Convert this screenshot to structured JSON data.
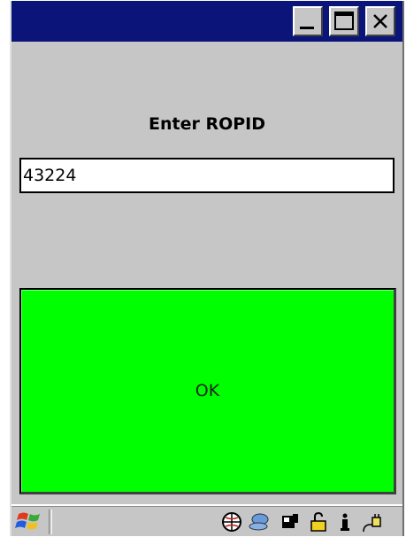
{
  "window": {
    "title": "",
    "controls": {
      "minimize": "minimize-icon",
      "maximize": "maximize-icon",
      "close": "close-icon"
    }
  },
  "main": {
    "prompt_label": "Enter ROPID",
    "ropid_value": "43224",
    "ok_label": "OK",
    "ok_color": "#00ff00"
  },
  "taskbar": {
    "start_icon": "windows-logo-icon",
    "tray_icons": [
      "network-globe-icon",
      "connection-icon",
      "storage-card-icon",
      "lock-icon",
      "info-icon",
      "power-plug-icon"
    ]
  },
  "colors": {
    "titlebar": "#0b1478",
    "window_bg": "#c6c6c6",
    "ok_button": "#00ff00"
  }
}
